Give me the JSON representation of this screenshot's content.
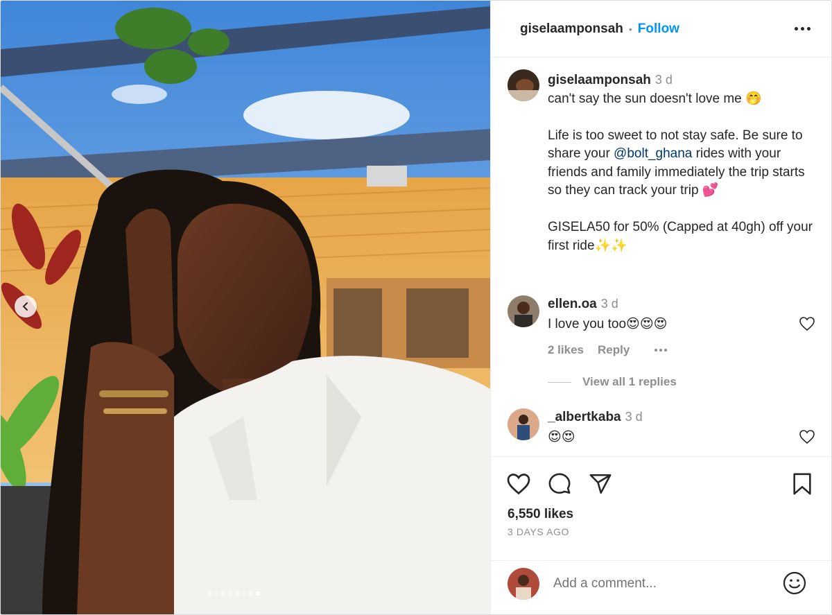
{
  "post": {
    "username": "giselaamponsah",
    "separator": "•",
    "follow_label": "Follow"
  },
  "caption": {
    "username": "giselaamponsah",
    "time": "3 d",
    "line1": "can't say the sun doesn't love me 🤭",
    "para2_a": "Life is too sweet to not stay safe. Be sure to share your ",
    "mention": "@bolt_ghana",
    "para2_b": " rides with your friends and family immediately the trip starts so they can track your trip 💕",
    "para3": "GISELA50 for 50% (Capped at 40gh) off your first ride✨✨"
  },
  "comments": [
    {
      "username": "ellen.oa",
      "time": "3 d",
      "text": "I love you too😍😍😍",
      "likes": "2 likes",
      "reply_label": "Reply",
      "view_replies": "View all 1 replies"
    },
    {
      "username": "_albertkaba",
      "time": "3 d",
      "text": "😍😍"
    }
  ],
  "stats": {
    "likes": "6,550 likes",
    "posted": "3 DAYS AGO"
  },
  "add_comment": {
    "placeholder": "Add a comment..."
  },
  "carousel": {
    "total": 8,
    "active_index": 7
  },
  "icons": {
    "more": "more-options-icon",
    "heart": "heart-icon",
    "comment": "comment-icon",
    "share": "share-icon",
    "save": "bookmark-icon",
    "emoji": "emoji-icon",
    "prev": "chevron-left-icon"
  },
  "colors": {
    "follow": "#0095f6",
    "mention": "#00376b",
    "muted": "#8e8e8e"
  }
}
